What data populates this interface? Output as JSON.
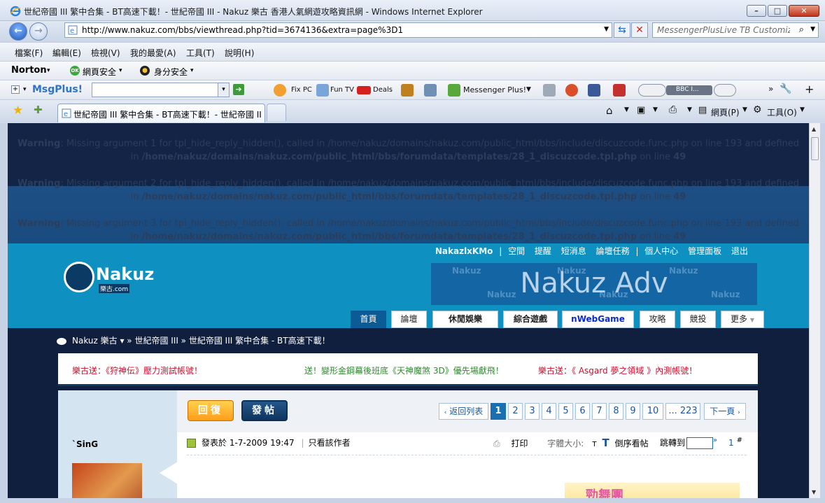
{
  "window": {
    "title": "世紀帝國 III 繁中合集 - BT高速下載！- 世紀帝國 III - Nakuz 樂古 香港人氣網遊攻略資訊網 - Windows Internet Explorer",
    "minimize": "–",
    "maximize": "□",
    "close": "✕"
  },
  "address": {
    "url": "http://www.nakuz.com/bbs/viewthread.php?tid=3674136&extra=page%3D1",
    "search_placeholder": "MessengerPlusLive TB Customized"
  },
  "menu": [
    "檔案(F)",
    "編輯(E)",
    "檢視(V)",
    "我的最愛(A)",
    "工具(T)",
    "說明(H)"
  ],
  "norton": {
    "brand": "Norton",
    "web_safety": "網頁安全",
    "identity_safety": "身分安全",
    "ok_badge": "OK"
  },
  "msgplus": {
    "brand": "MsgPlus!",
    "fix_pc": "Fix PC",
    "fun_tv": "Fun TV",
    "deals": "Deals",
    "messenger": "Messenger Plus!",
    "radio": "BBC I..."
  },
  "tab": {
    "label": "世紀帝國 III 繁中合集 - BT高速下載！- 世紀帝國 II...",
    "page_menu": "網頁(P)",
    "tools_menu": "工具(O)"
  },
  "warnings": [
    {
      "prefix": "Warning",
      "text": ": Missing argument 1 for tpl_hide_reply_hidden(), called in /home/nakuz/domains/nakuz.com/public_html/bbs/include/discuzcode.func.php on line 193 and defined",
      "line2_pre": "in ",
      "path": "/home/nakuz/domains/nakuz.com/public_html/bbs/forumdata/templates/28_1_discuzcode.tpl.php",
      "line2_mid": " on line ",
      "line": "49"
    },
    {
      "prefix": "Warning",
      "text": ": Missing argument 2 for tpl_hide_reply_hidden(), called in /home/nakuz/domains/nakuz.com/public_html/bbs/include/discuzcode.func.php on line 193 and defined",
      "line2_pre": "in ",
      "path": "/home/nakuz/domains/nakuz.com/public_html/bbs/forumdata/templates/28_1_discuzcode.tpl.php",
      "line2_mid": " on line ",
      "line": "49"
    },
    {
      "prefix": "Warning",
      "text": ": Missing argument 3 for tpl_hide_reply_hidden(), called in /home/nakuz/domains/nakuz.com/public_html/bbs/include/discuzcode.func.php on line 193 and defined",
      "line2_pre": "in ",
      "path": "/home/nakuz/domains/nakuz.com/public_html/bbs/forumdata/templates/28_1_discuzcode.tpl.php",
      "line2_mid": " on line ",
      "line": "49"
    }
  ],
  "site": {
    "username": "NakazlxKMo",
    "links": [
      "空間",
      "提醒",
      "短消息",
      "論壇任務",
      "個人中心",
      "管理面板",
      "退出"
    ],
    "logo_word": "Nakuz",
    "logo_sub": "樂古.com",
    "adv_text": "Nakuz Adv",
    "adv_watermark": "Nakuz",
    "nav": [
      "首頁",
      "論壇",
      "休閒娛樂",
      "綜合遊戲",
      "nWebGame",
      "攻略",
      "競投",
      "更多"
    ]
  },
  "breadcrumb": "Nakuz 樂古 ▾ » 世紀帝國 III » 世紀帝國 III 繁中合集 - BT高速下載！",
  "notices": [
    {
      "text": "樂古送：《狩神伝》壓力測試帳號！",
      "color": "#c8102e"
    },
    {
      "text": "送！變形金鋼幕後班底《天神魔煞 3D》優先場獻飛！",
      "color": "#2e8b2e"
    },
    {
      "text": "樂古送：《 Asgard 夢之領域 》內測帳號！",
      "color": "#c8102e"
    }
  ],
  "thread": {
    "reply_button": "回復",
    "post_button": "發帖",
    "back_to_list": "返回列表",
    "pages": [
      "1",
      "2",
      "3",
      "4",
      "5",
      "6",
      "7",
      "8",
      "9",
      "10"
    ],
    "last_page": "... 223",
    "next_page": "下一頁",
    "author": "`SinG",
    "posted": "發表於 1-7-2009 19:47",
    "only_author": "只看該作者",
    "print": "打印",
    "font_size": "字體大小:",
    "font_t_small": "T",
    "font_t_big": "T",
    "reverse": "倒序看帖",
    "jump_to": "跳轉到",
    "floor_no": "1",
    "floor_hash": "#",
    "ad_text": "勁舞團"
  }
}
